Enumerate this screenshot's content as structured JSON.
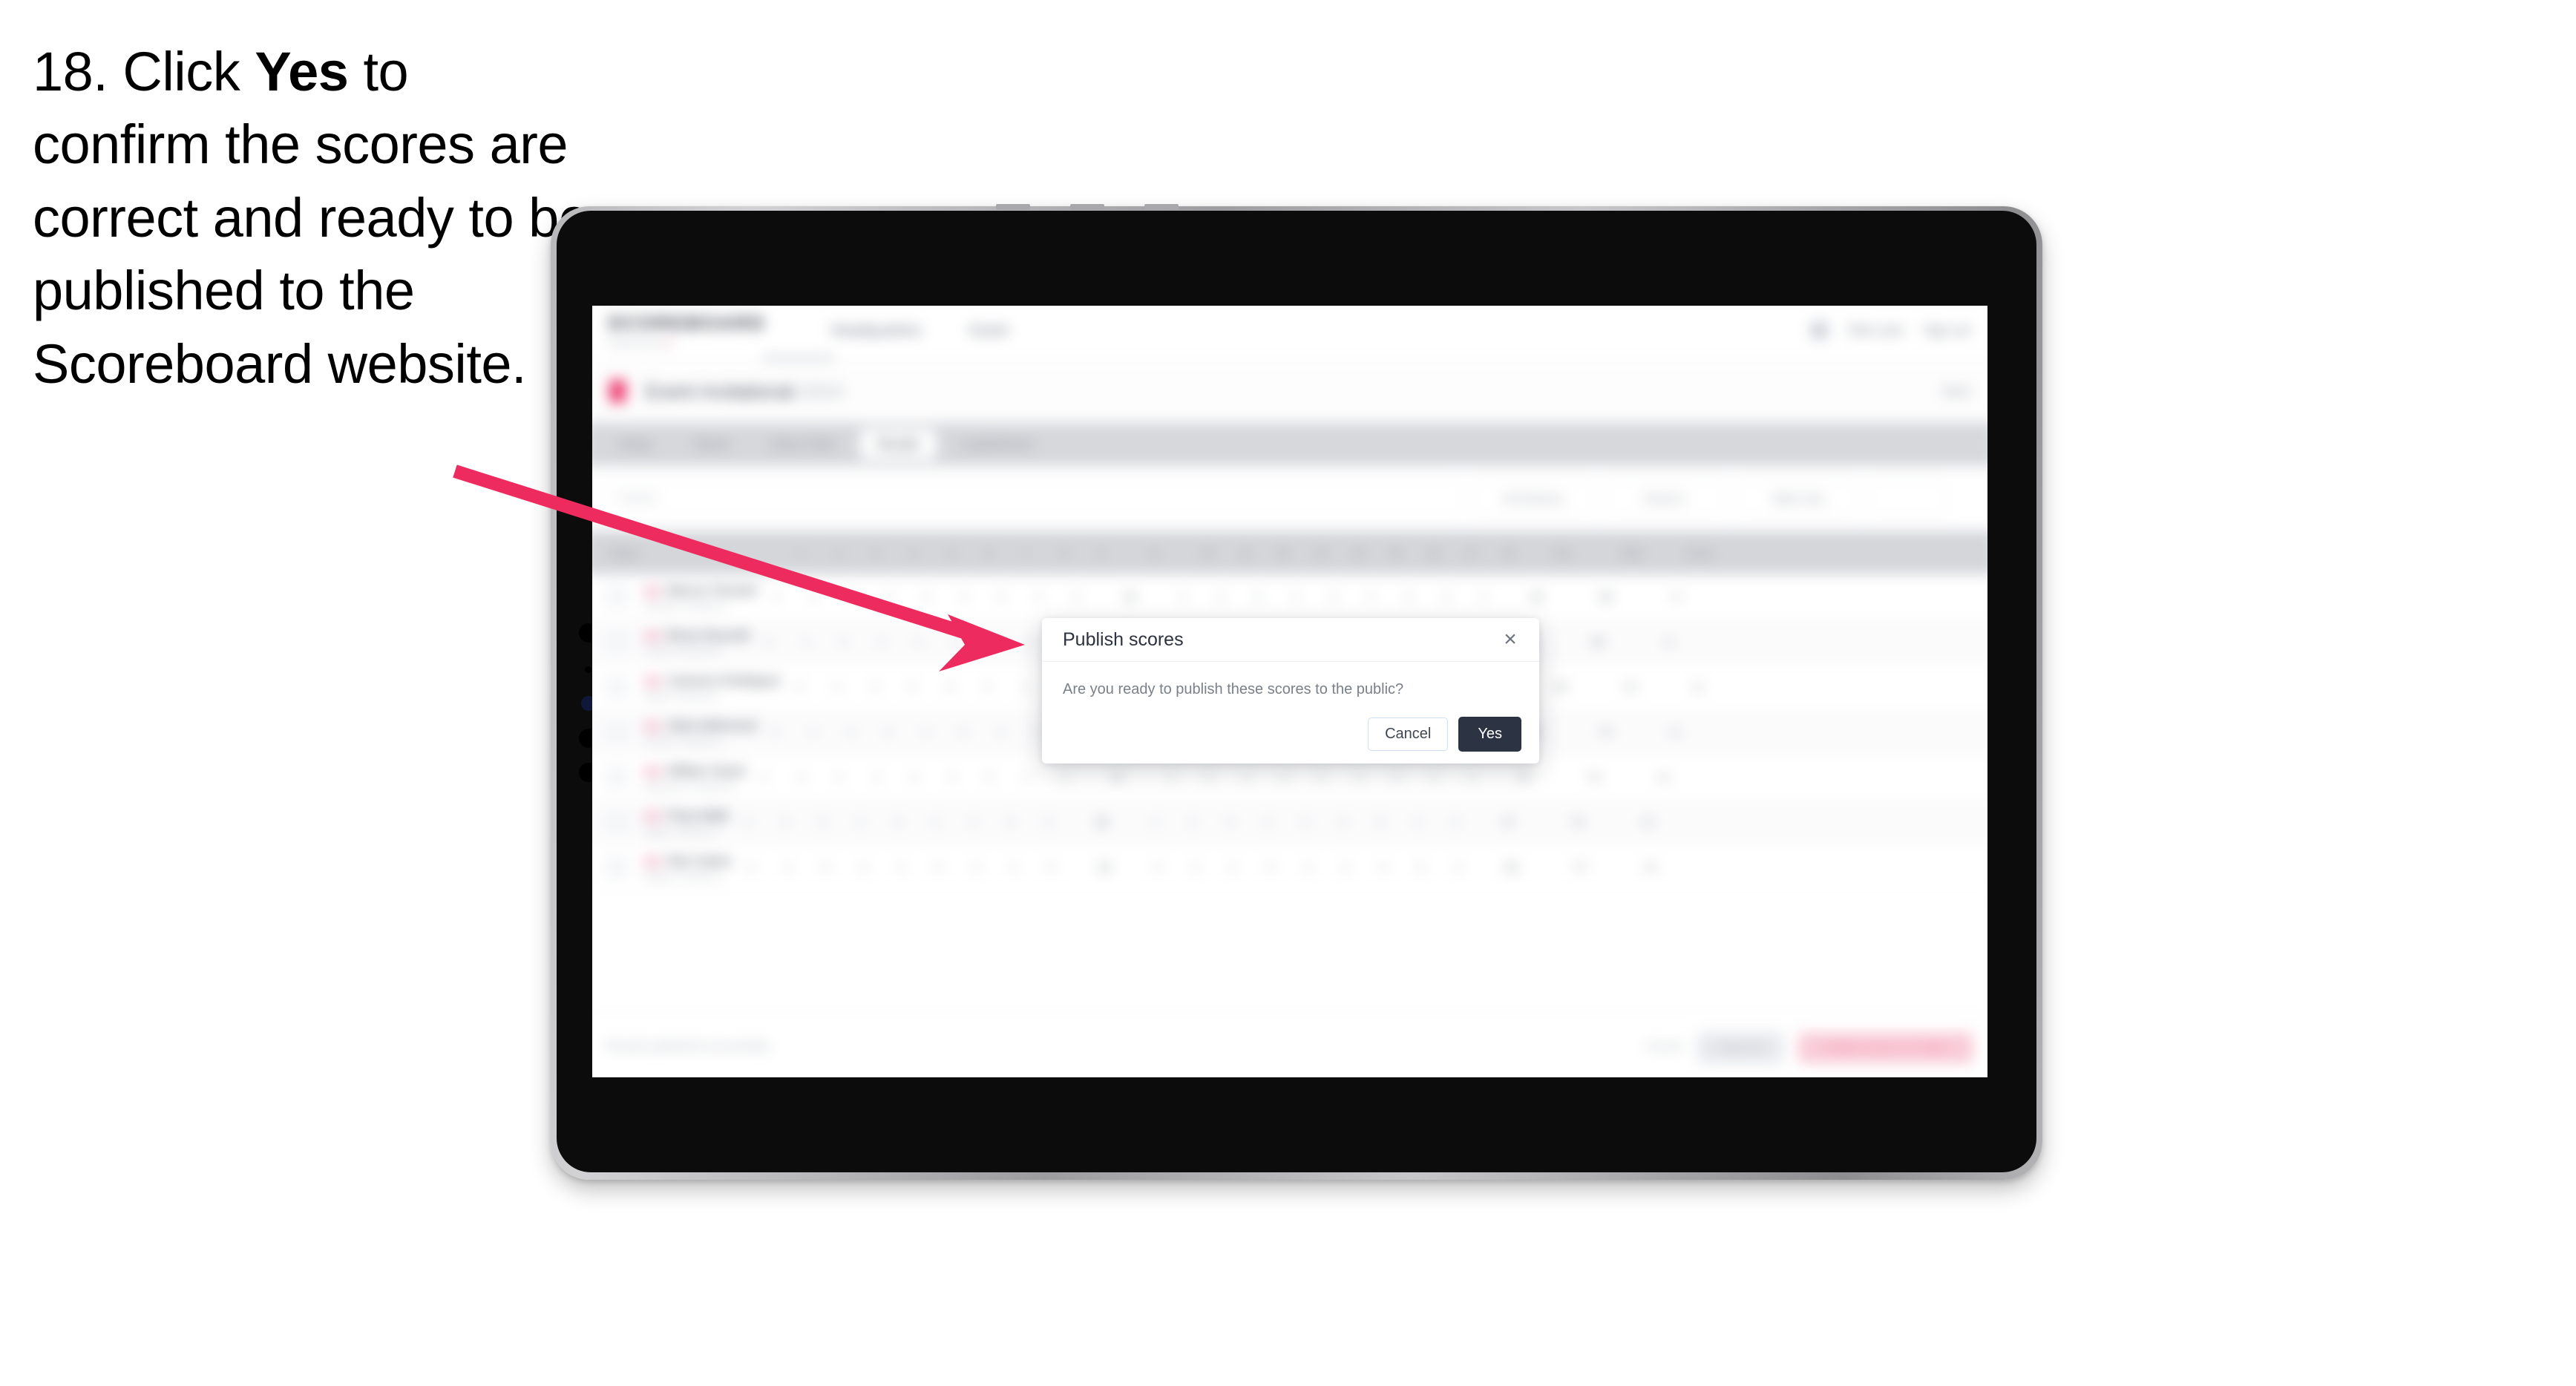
{
  "instruction": {
    "step": "18. Click ",
    "bold": "Yes",
    "rest": " to confirm the scores are correct and ready to be published to the Scoreboard website."
  },
  "colors": {
    "arrow": "#EE2B5E",
    "accent_pink": "#EC3A6E",
    "yes_button": "#2C3444",
    "bezel": "#0C0C0C"
  },
  "app": {
    "brand": {
      "name": "SCOREBOARD",
      "subtitle": "Powered by",
      "sub_dot": "●"
    },
    "nav": [
      "Headquarters",
      "Event"
    ],
    "account": {
      "user": "Rob Lane",
      "signout": "Sign out"
    },
    "title_bar": {
      "icon": "event-icon",
      "title": "Event Invitational",
      "title_muted": "2024",
      "right": "Next"
    },
    "tabs": [
      {
        "label": "Setup",
        "active": false
      },
      {
        "label": "Teams",
        "active": false
      },
      {
        "label": "Draw Order",
        "active": false
      },
      {
        "label": "Results",
        "active": true
      },
      {
        "label": "Leaderboard",
        "active": false
      }
    ],
    "filters": {
      "search_placeholder": "Search",
      "buttons": [
        "All Divisions",
        "Round 1",
        "Table Only"
      ]
    },
    "table": {
      "headers_left": "Player",
      "score_columns": [
        "1",
        "2",
        "3",
        "4",
        "5",
        "6",
        "7",
        "8",
        "9",
        "10",
        "11",
        "12",
        "13",
        "14",
        "15",
        "16",
        "17",
        "18"
      ],
      "headers_right": [
        "In",
        "Out",
        "Total",
        "Score"
      ],
      "rows": [
        {
          "name": "Marcus Tennant",
          "team": "Panthers / Division A",
          "scores": [
            "4",
            "3",
            "5",
            "4",
            "3",
            "4",
            "5",
            "4",
            "3",
            "4",
            "3",
            "5",
            "4",
            "3",
            "4",
            "5",
            "3",
            "4"
          ],
          "in": "33",
          "out": "35",
          "total": "68",
          "score": "-4"
        },
        {
          "name": "Elena Reynold",
          "team": "Cobras / Division B",
          "scores": [
            "3",
            "4",
            "5",
            "4",
            "4",
            "3",
            "5",
            "4",
            "4",
            "3",
            "4",
            "5",
            "3",
            "4",
            "4",
            "5",
            "4",
            "3"
          ],
          "in": "35",
          "out": "34",
          "total": "69",
          "score": "-3"
        },
        {
          "name": "Cameron Rodriguez",
          "team": "Hawks / Division A",
          "scores": [
            "4",
            "4",
            "4",
            "5",
            "3",
            "4",
            "4",
            "5",
            "3",
            "4",
            "4",
            "4",
            "5",
            "3",
            "4",
            "4",
            "4",
            "4"
          ],
          "in": "36",
          "out": "36",
          "total": "72",
          "score": "E"
        },
        {
          "name": "Sidra Mahmoud",
          "team": "Falcons / Division C",
          "scores": [
            "5",
            "4",
            "4",
            "3",
            "4",
            "5",
            "4",
            "3",
            "4",
            "5",
            "4",
            "3",
            "4",
            "5",
            "4",
            "3",
            "4",
            "5"
          ],
          "in": "36",
          "out": "37",
          "total": "73",
          "score": "+1"
        },
        {
          "name": "William Stuart",
          "team": "Wanderers / Division B",
          "scores": [
            "4",
            "5",
            "4",
            "4",
            "4",
            "3",
            "5",
            "4",
            "4",
            "4",
            "5",
            "4",
            "3",
            "4",
            "4",
            "5",
            "4",
            "4"
          ],
          "in": "37",
          "out": "37",
          "total": "74",
          "score": "+2"
        },
        {
          "name": "Priya Malik",
          "team": "Eagles / Division C",
          "scores": [
            "4",
            "4",
            "5",
            "4",
            "5",
            "4",
            "4",
            "5",
            "3",
            "4",
            "4",
            "5",
            "4",
            "4",
            "3",
            "5",
            "4",
            "4"
          ],
          "in": "38",
          "out": "37",
          "total": "75",
          "score": "+3"
        },
        {
          "name": "Nick Sutton",
          "team": "Raiders / Division A",
          "scores": [
            "5",
            "4",
            "5",
            "4",
            "4",
            "5",
            "4",
            "4",
            "5",
            "4",
            "4",
            "4",
            "5",
            "4",
            "4",
            "4",
            "5",
            "4"
          ],
          "in": "39",
          "out": "38",
          "total": "77",
          "score": "+5"
        }
      ]
    },
    "footer": {
      "note": "Results published successfully",
      "link": "Cancel",
      "gray_button": "Save All",
      "pink_button": "Publish Scores To Public"
    }
  },
  "modal": {
    "title": "Publish scores",
    "close_icon": "×",
    "body": "Are you ready to publish these scores to the public?",
    "cancel_label": "Cancel",
    "yes_label": "Yes"
  }
}
